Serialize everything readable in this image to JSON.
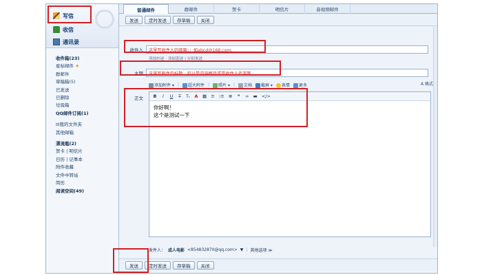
{
  "sidebar": {
    "compose_label": "写信",
    "inbox_label": "收信",
    "contacts_label": "通讯录",
    "folders": [
      {
        "label": "收件箱(23)",
        "bold": true
      },
      {
        "label": "星标邮件",
        "star": true
      },
      {
        "label": "群邮件"
      },
      {
        "label": "草稿箱(5)"
      },
      {
        "label": "已发送"
      },
      {
        "label": "已删除"
      },
      {
        "label": "垃圾箱"
      },
      {
        "label": "QQ邮件订阅(1)",
        "bold": true
      }
    ],
    "my_folders_header": "⊟我的文件夹",
    "other_mailbox": "其他邮箱",
    "tools": [
      {
        "label": "漂流瓶(2)",
        "bold": true
      },
      {
        "label": "贺卡 | 明信片"
      },
      {
        "label": "日历 | 记事本"
      },
      {
        "label": "附件收藏"
      },
      {
        "label": "文件中转站"
      },
      {
        "label": "简历"
      },
      {
        "label": "阅读空间(49)",
        "bold": true
      }
    ]
  },
  "tabs": [
    "普通邮件",
    "群邮件",
    "贺卡",
    "明信片",
    "音视频邮件"
  ],
  "toolbar": {
    "send": "发送",
    "scheduled_send": "定时发送",
    "save_draft": "存草稿",
    "close": "关闭"
  },
  "form": {
    "to_label": "收件人",
    "to_value": "这里写收件人的邮箱；；如abcd@168.com;",
    "to_links": "添加抄送 - 添加密送 | 分别发送",
    "subject_label": "主题",
    "subject_value": "这里写邮件的标题，可以是内容概括或是收件人名字等",
    "attach_bar": {
      "add_attachment": "添加附件",
      "large_attachment": "超大附件",
      "image": "照片",
      "document": "文档",
      "screenshot": "截屏",
      "emoji": "表情",
      "more": "更多",
      "format": "A 格式"
    },
    "body_label": "正文",
    "editor_toolbar": [
      "B",
      "I",
      "U",
      "T̶",
      "Tₜ",
      "A",
      "▦",
      "≡",
      "⁝≡",
      "≣",
      "❝",
      "∞",
      "▬",
      "</>"
    ],
    "body_lines": [
      "你好啊！",
      "这个是测试一下"
    ]
  },
  "sender": {
    "label": "发件人：",
    "name": "成人电影",
    "email": "<854832870@qq.com>",
    "dropdown": "▼",
    "other_options": "其他选项 ≫"
  },
  "colors": {
    "highlight": "#d31d22",
    "accent": "#153e73"
  }
}
